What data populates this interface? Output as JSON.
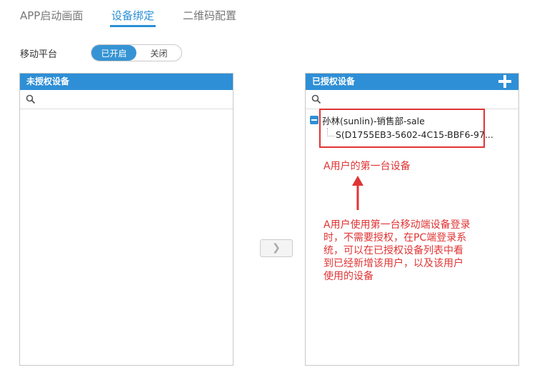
{
  "tabs": [
    {
      "label": "APP启动画面"
    },
    {
      "label": "设备绑定",
      "active": true
    },
    {
      "label": "二维码配置"
    }
  ],
  "platform": {
    "label": "移动平台",
    "on_label": "已开启",
    "off_label": "关闭",
    "selected": "on"
  },
  "left_panel": {
    "title": "未授权设备",
    "search_placeholder": ""
  },
  "right_panel": {
    "title": "已授权设备",
    "search_placeholder": "",
    "tree": {
      "parent_label": "孙林(sunlin)-销售部-sale",
      "child_label": "S(D1755EB3-5602-4C15-BBF6-97..."
    }
  },
  "move_button": {
    "label": "❯"
  },
  "annotations": {
    "first_device": "A用户的第一台设备",
    "explanation_lines": [
      "A用户使用第一台移动端设备登录",
      "时，不需要授权，在PC端登录系",
      "统，可以在已授权设备列表中看",
      "到已经新增该用户，以及该用户",
      "使用的设备"
    ]
  },
  "colors": {
    "accent": "#2e8fd6",
    "annotation": "#e03434"
  }
}
